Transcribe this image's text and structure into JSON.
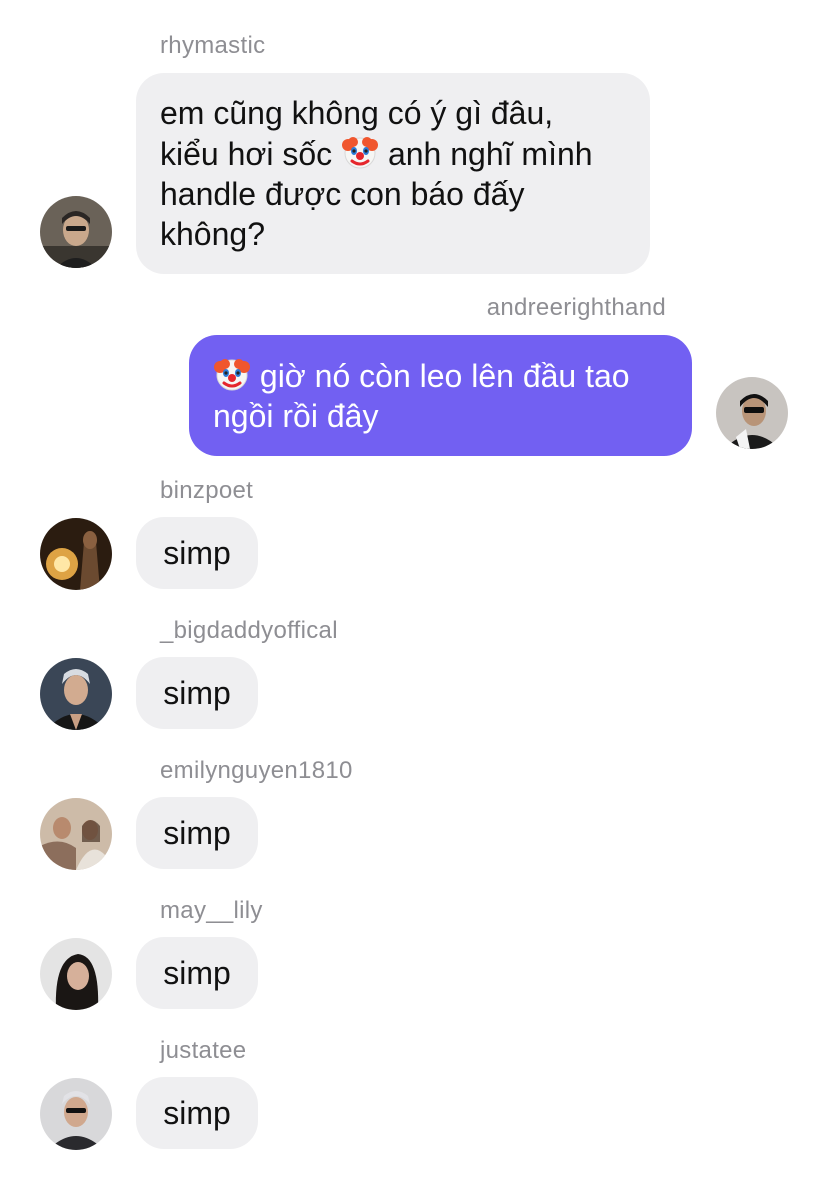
{
  "messages": [
    {
      "user": "rhymastic",
      "line1": "em cũng không có ý gì đâu,",
      "line2a": "kiểu hơi sốc",
      "emoji": "clown-face-emoji",
      "line2b": "anh nghĩ mình",
      "line3": "handle được con báo đấy",
      "line4": "không?"
    },
    {
      "user": "andreerighthand",
      "emoji": "clown-face-emoji",
      "line1": "giờ nó còn leo lên đầu tao",
      "line2": "ngồi rồi đây"
    },
    {
      "user": "binzpoet",
      "text": "simp"
    },
    {
      "user": "_bigdaddyoffical",
      "text": "simp"
    },
    {
      "user": "emilynguyen1810",
      "text": "simp"
    },
    {
      "user": "may__lily",
      "text": "simp"
    },
    {
      "user": "justatee",
      "text": "simp"
    }
  ],
  "colors": {
    "incoming_bubble": "#efeff1",
    "outgoing_bubble": "#7260f2",
    "username": "#8e8e93"
  }
}
